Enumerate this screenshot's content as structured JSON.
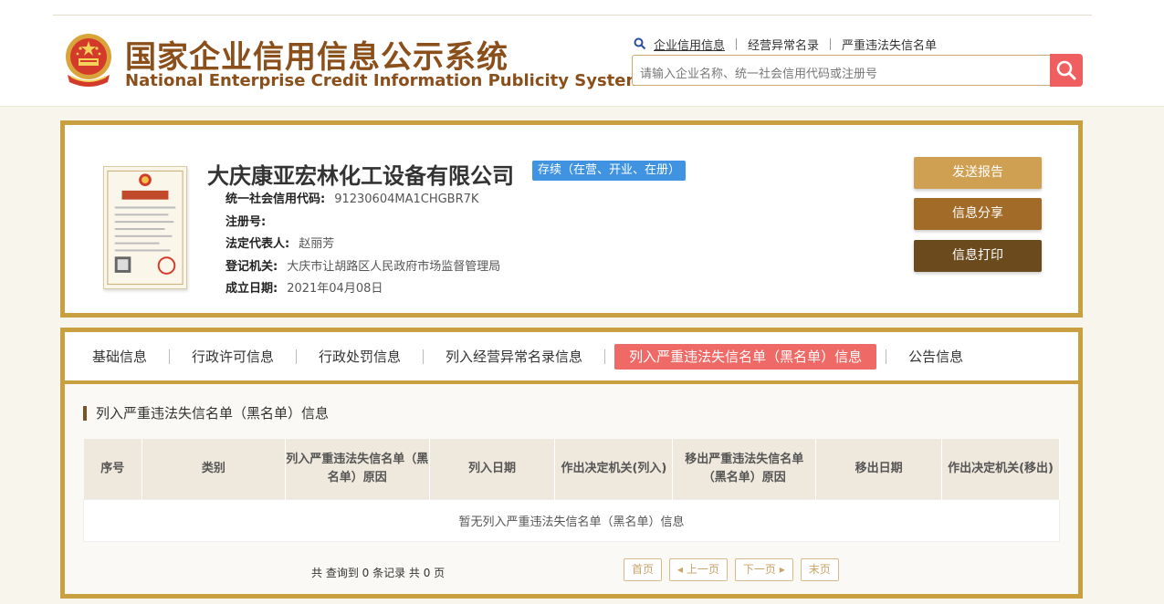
{
  "header": {
    "title_cn": "国家企业信用信息公示系统",
    "title_en": "National Enterprise Credit Information Publicity System",
    "links": [
      "企业信用信息",
      "经营异常名录",
      "严重违法失信名单"
    ],
    "search_placeholder": "请输入企业名称、统一社会信用代码或注册号",
    "emblem_icon": "national-emblem-icon",
    "search_icon": "search-icon"
  },
  "company": {
    "name": "大庆康亚宏林化工设备有限公司",
    "status": "存续（在营、开业、在册）",
    "license_icon": "business-license-icon",
    "fields": [
      {
        "label": "统一社会信用代码:",
        "value": "91230604MA1CHGBR7K"
      },
      {
        "label": "注册号:",
        "value": ""
      },
      {
        "label": "法定代表人:",
        "value": "赵丽芳"
      },
      {
        "label": "登记机关:",
        "value": "大庆市让胡路区人民政府市场监督管理局"
      },
      {
        "label": "成立日期:",
        "value": "2021年04月08日"
      }
    ]
  },
  "actions": {
    "send_report": "发送报告",
    "share": "信息分享",
    "print": "信息打印"
  },
  "tabs": [
    "基础信息",
    "行政许可信息",
    "行政处罚信息",
    "列入经营异常名录信息",
    "列入严重违法失信名单（黑名单）信息",
    "公告信息"
  ],
  "section": {
    "title": "列入严重违法失信名单（黑名单）信息",
    "columns": [
      "序号",
      "类别",
      "列入严重违法失信名单（黑名单）原因",
      "列入日期",
      "作出决定机关(列入)",
      "移出严重违法失信名单（黑名单）原因",
      "移出日期",
      "作出决定机关(移出)"
    ],
    "empty_text": "暂无列入严重违法失信名单（黑名单）信息"
  },
  "pagination": {
    "summary": "共 查询到 0 条记录 共 0 页",
    "first": "首页",
    "prev": "上一页",
    "next": "下一页",
    "last": "末页"
  },
  "colors": {
    "brand": "#8a4f1a",
    "border_gold": "#c9a03f",
    "status_blue": "#3f93e0",
    "active_tab": "#ef6a66",
    "search_button": "#ef5f5f"
  }
}
